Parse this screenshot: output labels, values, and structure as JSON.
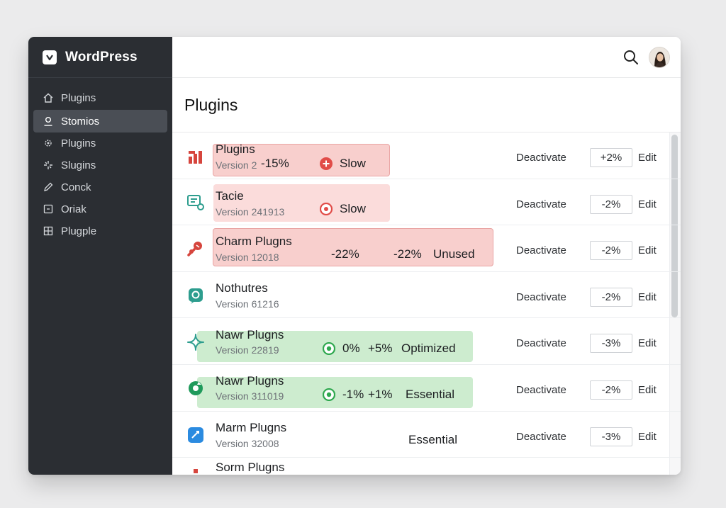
{
  "app": {
    "title": "WordPress"
  },
  "sidebar": {
    "items": [
      {
        "label": "Plugins",
        "icon": "home-icon",
        "active": false
      },
      {
        "label": "Stomios",
        "icon": "user-icon",
        "active": true
      },
      {
        "label": "Plugins",
        "icon": "plugin-gear-icon",
        "active": false
      },
      {
        "label": "Slugins",
        "icon": "sparkle-icon",
        "active": false
      },
      {
        "label": "Conck",
        "icon": "pencil-icon",
        "active": false
      },
      {
        "label": "Oriak",
        "icon": "box-icon",
        "active": false
      },
      {
        "label": "Plugple",
        "icon": "grid-icon",
        "active": false
      }
    ]
  },
  "header": {
    "search_icon": "search-icon",
    "avatar": "user-avatar"
  },
  "page": {
    "title": "Plugins"
  },
  "actions": {
    "deactivate": "Deactivate",
    "edit": "Edit"
  },
  "plugins": [
    {
      "name": "Plugins",
      "version": "Version 2",
      "impact": "+2%",
      "stat1": "-15%",
      "status": "Slow",
      "icon_color": "#d6453d"
    },
    {
      "name": "Tacie",
      "version": "Version 241913",
      "impact": "-2%",
      "status": "Slow",
      "icon_color": "#2d9d8e"
    },
    {
      "name": "Charm Plugns",
      "version": "Version 12018",
      "impact": "-2%",
      "stat1": "-22%",
      "stat2": "-22%",
      "status": "Unused",
      "icon_color": "#d6453d"
    },
    {
      "name": "Nothutres",
      "version": "Version 61216",
      "impact": "-2%",
      "icon_color": "#2d9d8e"
    },
    {
      "name": "Nawr Plugns",
      "version": "Version 22819",
      "impact": "-3%",
      "stat1": "0%",
      "stat2": "+5%",
      "status": "Optimized",
      "icon_color": "#2d9d8e"
    },
    {
      "name": "Nawr Plugns",
      "version": "Version 311019",
      "impact": "-2%",
      "stat1": "-1%",
      "stat2": "+1%",
      "status": "Essential",
      "icon_color": "#1f9a5b"
    },
    {
      "name": "Marm Plugns",
      "version": "Version 32008",
      "impact": "-3%",
      "status": "Essential",
      "icon_color": "#2b8be0"
    },
    {
      "name": "Sorm Plugns"
    }
  ],
  "colors": {
    "sidebar": "#2b2e33",
    "warning": "#e14c48",
    "success": "#2fa84f",
    "accent": "#2b8be0"
  }
}
